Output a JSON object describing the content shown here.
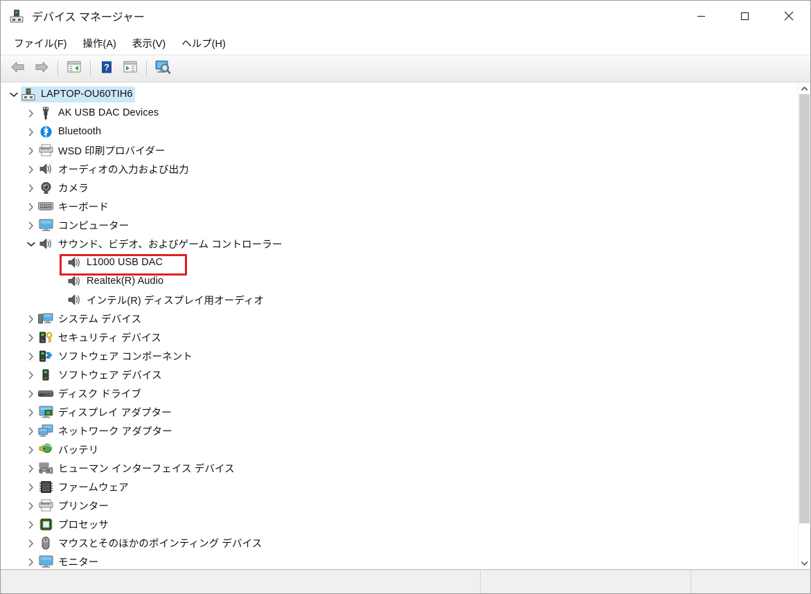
{
  "window": {
    "title": "デバイス マネージャー",
    "title_icon": "device-manager-icon",
    "controls": {
      "minimize": "最小化",
      "maximize": "最大化",
      "close": "閉じる"
    }
  },
  "menubar": {
    "items": [
      {
        "label": "ファイル(F)",
        "name": "menu-file"
      },
      {
        "label": "操作(A)",
        "name": "menu-action"
      },
      {
        "label": "表示(V)",
        "name": "menu-view"
      },
      {
        "label": "ヘルプ(H)",
        "name": "menu-help"
      }
    ]
  },
  "toolbar": {
    "buttons": [
      {
        "icon": "back-arrow-icon",
        "name": "toolbar-back"
      },
      {
        "icon": "forward-arrow-icon",
        "name": "toolbar-forward"
      },
      {
        "icon": "properties-icon",
        "name": "toolbar-properties"
      },
      {
        "icon": "help-icon",
        "name": "toolbar-help"
      },
      {
        "icon": "update-driver-icon",
        "name": "toolbar-update-driver"
      },
      {
        "icon": "scan-hardware-icon",
        "name": "toolbar-scan-hardware"
      }
    ]
  },
  "tree": {
    "root": {
      "label": "LAPTOP-OU60TIH6",
      "icon": "computer-root-icon",
      "expanded": true,
      "selected": true
    },
    "nodes": [
      {
        "label": "AK USB DAC Devices",
        "icon": "usb-icon",
        "level": 1,
        "state": "collapsed"
      },
      {
        "label": "Bluetooth",
        "icon": "bluetooth-icon",
        "level": 1,
        "state": "collapsed"
      },
      {
        "label": "WSD 印刷プロバイダー",
        "icon": "printer-icon",
        "level": 1,
        "state": "collapsed"
      },
      {
        "label": "オーディオの入力および出力",
        "icon": "speaker-icon",
        "level": 1,
        "state": "collapsed"
      },
      {
        "label": "カメラ",
        "icon": "camera-icon",
        "level": 1,
        "state": "collapsed"
      },
      {
        "label": "キーボード",
        "icon": "keyboard-icon",
        "level": 1,
        "state": "collapsed"
      },
      {
        "label": "コンピューター",
        "icon": "monitor-icon",
        "level": 1,
        "state": "collapsed"
      },
      {
        "label": "サウンド、ビデオ、およびゲーム コントローラー",
        "icon": "speaker-icon",
        "level": 1,
        "state": "expanded"
      },
      {
        "label": "L1000 USB DAC",
        "icon": "speaker-icon",
        "level": 2,
        "state": "leaf",
        "highlighted": true
      },
      {
        "label": "Realtek(R) Audio",
        "icon": "speaker-icon",
        "level": 2,
        "state": "leaf"
      },
      {
        "label": "インテル(R) ディスプレイ用オーディオ",
        "icon": "speaker-icon",
        "level": 2,
        "state": "leaf"
      },
      {
        "label": "システム デバイス",
        "icon": "system-devices-icon",
        "level": 1,
        "state": "collapsed"
      },
      {
        "label": "セキュリティ デバイス",
        "icon": "security-device-icon",
        "level": 1,
        "state": "collapsed"
      },
      {
        "label": "ソフトウェア コンポーネント",
        "icon": "software-component-icon",
        "level": 1,
        "state": "collapsed"
      },
      {
        "label": "ソフトウェア デバイス",
        "icon": "software-device-icon",
        "level": 1,
        "state": "collapsed"
      },
      {
        "label": "ディスク ドライブ",
        "icon": "disk-drive-icon",
        "level": 1,
        "state": "collapsed"
      },
      {
        "label": "ディスプレイ アダプター",
        "icon": "display-adapter-icon",
        "level": 1,
        "state": "collapsed"
      },
      {
        "label": "ネットワーク アダプター",
        "icon": "network-adapter-icon",
        "level": 1,
        "state": "collapsed"
      },
      {
        "label": "バッテリ",
        "icon": "battery-icon",
        "level": 1,
        "state": "collapsed"
      },
      {
        "label": "ヒューマン インターフェイス デバイス",
        "icon": "hid-icon",
        "level": 1,
        "state": "collapsed"
      },
      {
        "label": "ファームウェア",
        "icon": "firmware-icon",
        "level": 1,
        "state": "collapsed"
      },
      {
        "label": "プリンター",
        "icon": "printer-icon",
        "level": 1,
        "state": "collapsed"
      },
      {
        "label": "プロセッサ",
        "icon": "processor-icon",
        "level": 1,
        "state": "collapsed"
      },
      {
        "label": "マウスとそのほかのポインティング デバイス",
        "icon": "mouse-icon",
        "level": 1,
        "state": "collapsed"
      },
      {
        "label": "モニター",
        "icon": "monitor-icon",
        "level": 1,
        "state": "collapsed"
      }
    ]
  },
  "annotation": {
    "target_label": "L1000 USB DAC",
    "color": "#e02020"
  },
  "scrollbar": {
    "up_arrow": "scroll-up-icon",
    "down_arrow": "scroll-down-icon"
  },
  "statusbar": {
    "pane1": "",
    "pane2": "",
    "pane3": ""
  }
}
